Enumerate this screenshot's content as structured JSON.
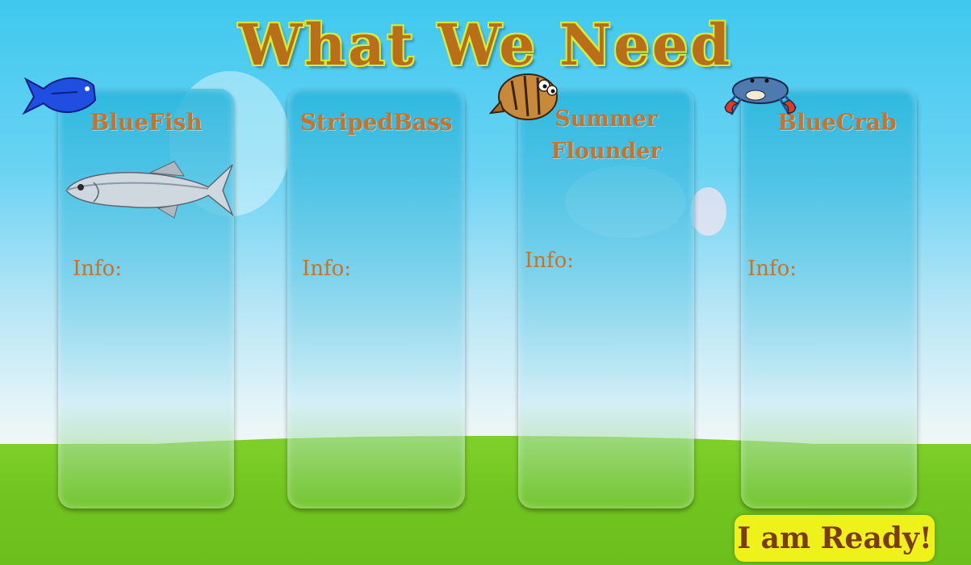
{
  "title": "What We Need",
  "cards": [
    {
      "name": "BlueFish",
      "info_label": "Info:"
    },
    {
      "name": "StripedBass",
      "info_label": "Info:"
    },
    {
      "name": "Summer Flounder",
      "info_label": "Info:"
    },
    {
      "name": "BlueCrab",
      "info_label": "Info:"
    }
  ],
  "ready_button": "I am Ready!",
  "icons": {
    "bluefish_token": "blue-fish-icon",
    "bluefish_picture": "bluefish-illustration",
    "flounder_token": "flounder-icon",
    "crab_token": "blue-crab-icon"
  },
  "colors": {
    "title": "#b96f1a",
    "card_text": "#c8732a",
    "button": "#eef21a",
    "button_text": "#7a3c10",
    "grass": "#72c520"
  }
}
